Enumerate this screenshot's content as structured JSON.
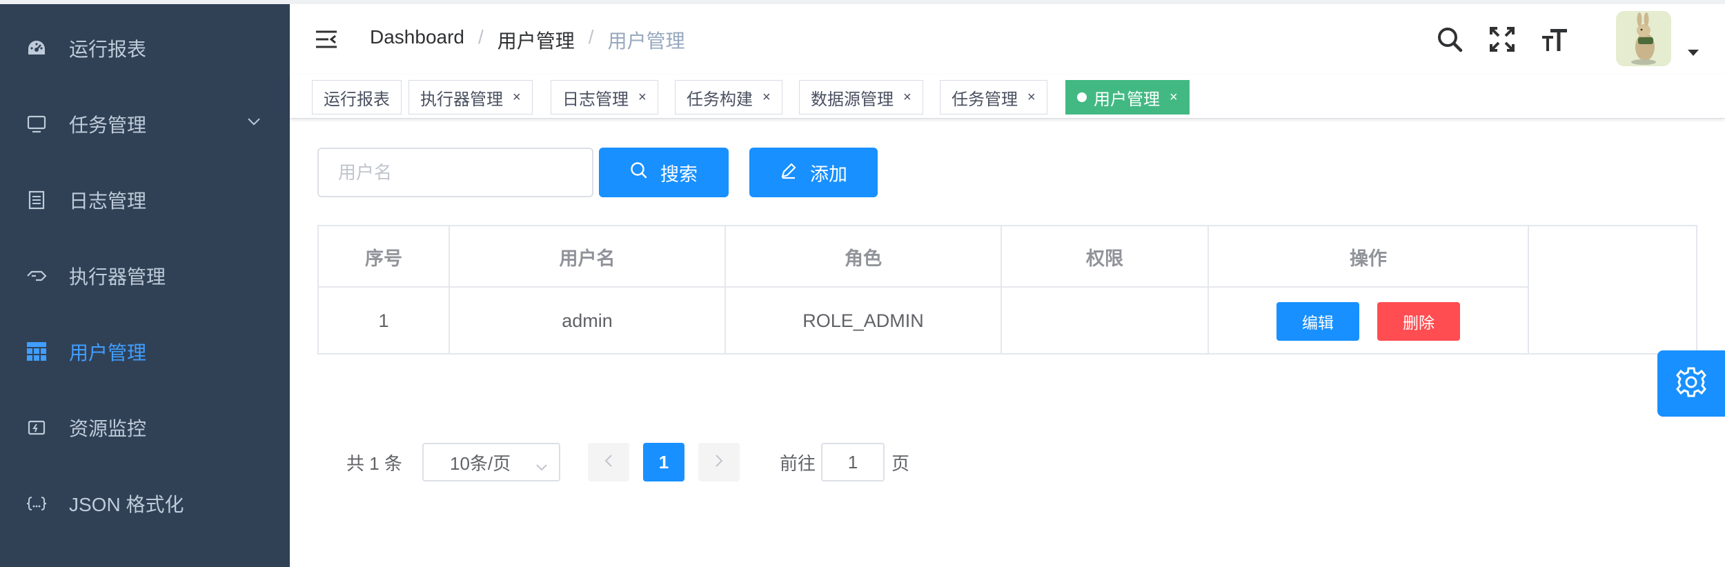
{
  "sidebar": {
    "items": [
      {
        "label": "运行报表",
        "icon": "dashboard-icon"
      },
      {
        "label": "任务管理",
        "icon": "monitor-icon",
        "expandable": true
      },
      {
        "label": "日志管理",
        "icon": "document-icon"
      },
      {
        "label": "执行器管理",
        "icon": "executor-icon"
      },
      {
        "label": "用户管理",
        "icon": "table-icon",
        "active": true
      },
      {
        "label": "资源监控",
        "icon": "monitor-resource-icon"
      },
      {
        "label": "JSON 格式化",
        "icon": "json-braces-icon"
      }
    ]
  },
  "header": {
    "breadcrumb": [
      "Dashboard",
      "用户管理",
      "用户管理"
    ],
    "icons": [
      "search-icon",
      "fullscreen-icon",
      "font-size-icon"
    ]
  },
  "tags": [
    {
      "label": "运行报表",
      "closable": false
    },
    {
      "label": "执行器管理",
      "closable": true
    },
    {
      "label": "日志管理",
      "closable": true
    },
    {
      "label": "任务构建",
      "closable": true
    },
    {
      "label": "数据源管理",
      "closable": true
    },
    {
      "label": "任务管理",
      "closable": true
    },
    {
      "label": "用户管理",
      "closable": true,
      "active": true
    }
  ],
  "tag_close_glyph": "×",
  "toolbar": {
    "search_placeholder": "用户名",
    "search_label": "搜索",
    "add_label": "添加"
  },
  "table": {
    "columns": [
      "序号",
      "用户名",
      "角色",
      "权限",
      "操作"
    ],
    "rows": [
      {
        "index": "1",
        "username": "admin",
        "role": "ROLE_ADMIN",
        "permission": "",
        "edit_label": "编辑",
        "delete_label": "删除"
      }
    ]
  },
  "pagination": {
    "total_text": "共 1 条",
    "page_size": "10条/页",
    "current_page": "1",
    "goto_prefix": "前往",
    "goto_value": "1",
    "goto_suffix": "页"
  },
  "colors": {
    "sidebar_bg": "#304156",
    "sidebar_text": "#bfcbd9",
    "active": "#409eff",
    "primary_button": "#1890ff",
    "danger_button": "#ff4d51",
    "active_tag": "#42b983"
  }
}
